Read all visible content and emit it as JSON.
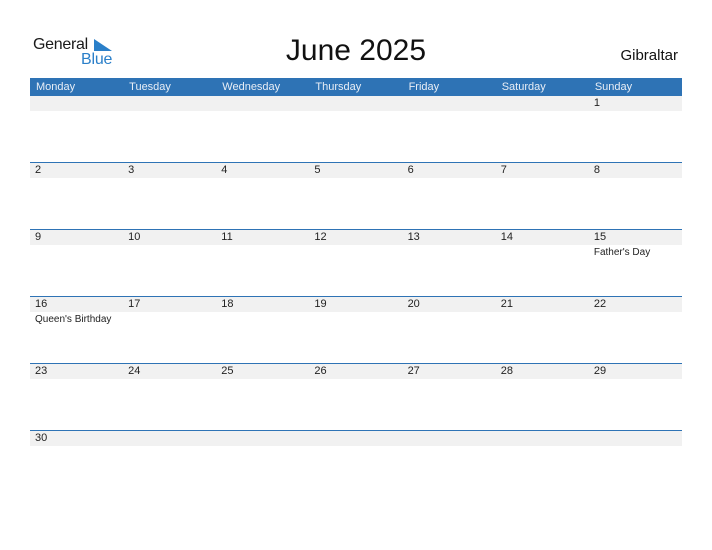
{
  "logo": {
    "line1": "General",
    "line2": "Blue"
  },
  "title": "June 2025",
  "region": "Gibraltar",
  "colors": {
    "accent": "#2e73b5",
    "logo_blue": "#2a7fc9",
    "row_bg": "#f1f1f1"
  },
  "weekdays": [
    "Monday",
    "Tuesday",
    "Wednesday",
    "Thursday",
    "Friday",
    "Saturday",
    "Sunday"
  ],
  "weeks": [
    [
      {
        "day": ""
      },
      {
        "day": ""
      },
      {
        "day": ""
      },
      {
        "day": ""
      },
      {
        "day": ""
      },
      {
        "day": ""
      },
      {
        "day": "1"
      }
    ],
    [
      {
        "day": "2"
      },
      {
        "day": "3"
      },
      {
        "day": "4"
      },
      {
        "day": "5"
      },
      {
        "day": "6"
      },
      {
        "day": "7"
      },
      {
        "day": "8"
      }
    ],
    [
      {
        "day": "9"
      },
      {
        "day": "10"
      },
      {
        "day": "11"
      },
      {
        "day": "12"
      },
      {
        "day": "13"
      },
      {
        "day": "14"
      },
      {
        "day": "15",
        "event": "Father's Day"
      }
    ],
    [
      {
        "day": "16",
        "event": "Queen's Birthday"
      },
      {
        "day": "17"
      },
      {
        "day": "18"
      },
      {
        "day": "19"
      },
      {
        "day": "20"
      },
      {
        "day": "21"
      },
      {
        "day": "22"
      }
    ],
    [
      {
        "day": "23"
      },
      {
        "day": "24"
      },
      {
        "day": "25"
      },
      {
        "day": "26"
      },
      {
        "day": "27"
      },
      {
        "day": "28"
      },
      {
        "day": "29"
      }
    ],
    [
      {
        "day": "30"
      },
      {
        "day": ""
      },
      {
        "day": ""
      },
      {
        "day": ""
      },
      {
        "day": ""
      },
      {
        "day": ""
      },
      {
        "day": ""
      }
    ]
  ]
}
